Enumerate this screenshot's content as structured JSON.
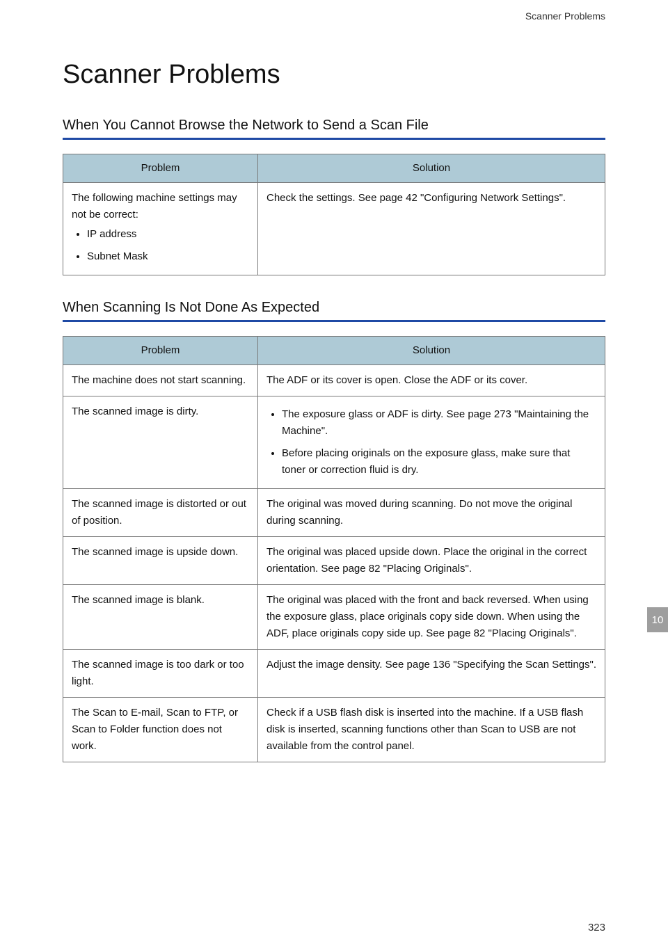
{
  "header": {
    "running_title": "Scanner Problems"
  },
  "page_title": "Scanner Problems",
  "section1": {
    "heading": "When You Cannot Browse the Network to Send a Scan File",
    "columns": {
      "problem": "Problem",
      "solution": "Solution"
    },
    "rows": [
      {
        "problem_intro": "The following machine settings may not be correct:",
        "problem_items": [
          "IP address",
          "Subnet Mask"
        ],
        "solution_text": "Check the settings. See page 42 \"Configuring Network Settings\"."
      }
    ]
  },
  "section2": {
    "heading": "When Scanning Is Not Done As Expected",
    "columns": {
      "problem": "Problem",
      "solution": "Solution"
    },
    "rows": [
      {
        "problem": "The machine does not start scanning.",
        "solution_text": "The ADF or its cover is open. Close the ADF or its cover."
      },
      {
        "problem": "The scanned image is dirty.",
        "solution_items": [
          "The exposure glass or ADF is dirty. See page 273 \"Maintaining the Machine\".",
          "Before placing originals on the exposure glass, make sure that toner or correction fluid is dry."
        ]
      },
      {
        "problem": "The scanned image is distorted or out of position.",
        "solution_text": "The original was moved during scanning. Do not move the original during scanning."
      },
      {
        "problem": "The scanned image is upside down.",
        "solution_text": "The original was placed upside down. Place the original in the correct orientation. See page 82 \"Placing Originals\"."
      },
      {
        "problem": "The scanned image is blank.",
        "solution_text": "The original was placed with the front and back reversed. When using the exposure glass, place originals copy side down. When using the ADF, place originals copy side up. See page 82 \"Placing Originals\"."
      },
      {
        "problem": "The scanned image is too dark or too light.",
        "solution_text": "Adjust the image density. See page 136 \"Specifying the Scan Settings\"."
      },
      {
        "problem": "The Scan to E-mail, Scan to FTP, or Scan to Folder function does not work.",
        "solution_text": "Check if a USB flash disk is inserted into the machine. If a USB flash disk is inserted, scanning functions other than Scan to USB are not available from the control panel."
      }
    ]
  },
  "side_tab": "10",
  "page_number": "323"
}
